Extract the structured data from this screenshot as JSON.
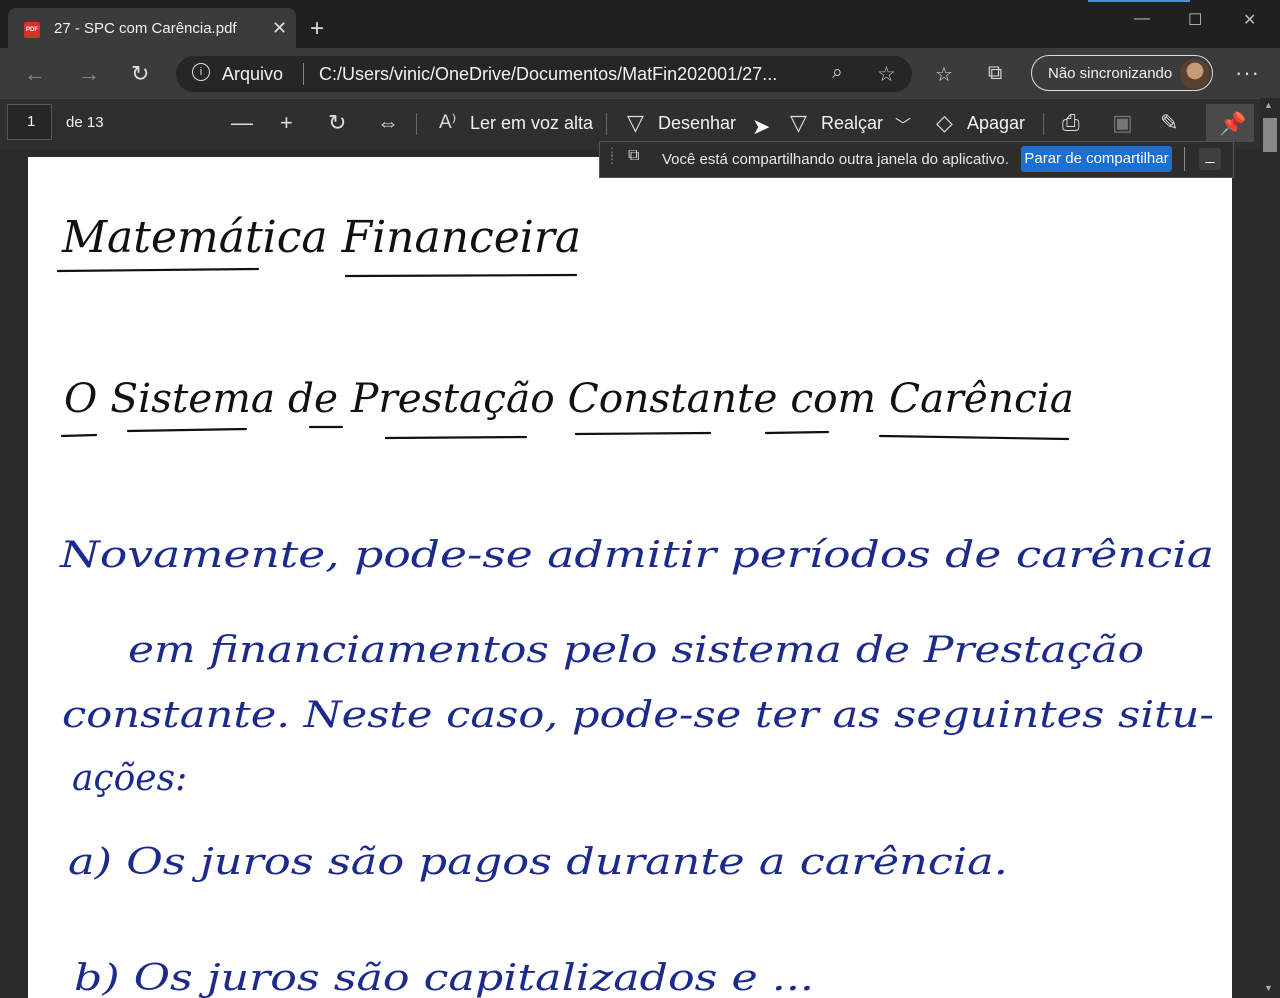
{
  "browser": {
    "tab_title": "27 - SPC com Carência.pdf",
    "tab_icon": "pdf-icon",
    "address_label": "Arquivo",
    "url": "C:/Users/vinic/OneDrive/Documentos/MatFin202001/27...",
    "profile_label": "Não sincronizando",
    "accent_color": "#4a90d9"
  },
  "pdf_toolbar": {
    "page_number": "1",
    "page_total": "de 13",
    "read_aloud": "Ler em voz alta",
    "draw": "Desenhar",
    "highlight": "Realçar",
    "erase": "Apagar"
  },
  "share_banner": {
    "message": "Você está compartilhando outra janela do aplicativo.",
    "stop_button": "Parar de compartilhar",
    "button_color": "#1a6fd0"
  },
  "document": {
    "ink_title": "#111111",
    "ink_body": "#1c2a8c",
    "title": "Matemática Financeira",
    "subtitle": "O Sistema de Prestação Constante com Carência",
    "paragraph_lines": [
      "Novamente, pode-se admitir períodos de carência",
      "em financiamentos pelo sistema de Prestação",
      "constante. Neste caso, pode-se ter as seguintes situ-",
      "ações:"
    ],
    "item_a": "a) Os juros são pagos durante a carência.",
    "item_b": "b) Os juros são capitalizados e ..."
  }
}
